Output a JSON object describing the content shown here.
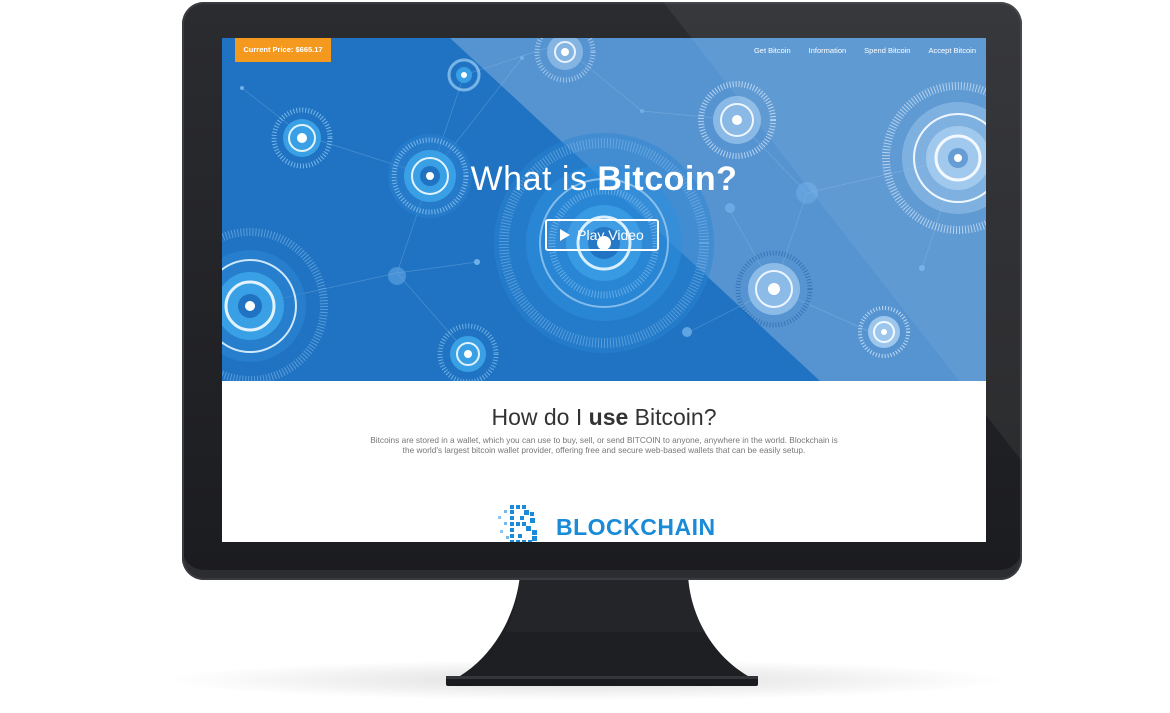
{
  "price_badge": {
    "label": "Current Price:",
    "value": "$665.17"
  },
  "nav": {
    "items": [
      "Get Bitcoin",
      "Information",
      "Spend Bitcoin",
      "Accept Bitcoin"
    ]
  },
  "hero": {
    "title_prefix": "What is ",
    "title_bold": "Bitcoin?",
    "play_label": "Play Video"
  },
  "section": {
    "title_prefix": "How do I ",
    "title_bold": "use",
    "title_suffix": " Bitcoin?",
    "body": "Bitcoins are stored in a wallet, which you can use to buy, sell, or send BITCOIN to anyone, anywhere in the world. Blockchain is the world's largest bitcoin wallet provider, offering free and secure web-based wallets that can be easily setup."
  },
  "logo": {
    "word": "BLOCKCHAIN"
  },
  "colors": {
    "hero_blue": "#1f73c2",
    "badge_orange": "#f5991e",
    "logo_blue": "#1a8bd8",
    "bezel": "#1e1f22"
  }
}
